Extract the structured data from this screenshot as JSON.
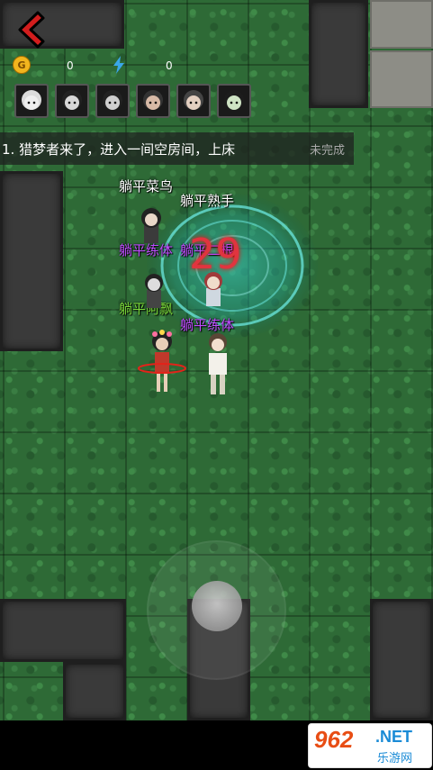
{
  "hud": {
    "coin_icon_letter": "G",
    "coins": "0",
    "energy": "0"
  },
  "avatars": [
    "avatar-1",
    "avatar-2",
    "avatar-3",
    "avatar-4",
    "avatar-5",
    "avatar-6"
  ],
  "task": {
    "text": "1. 猎梦者来了，进入一间空房间，上床",
    "status": "未完成"
  },
  "players": [
    {
      "name": "躺平菜鸟",
      "color": "#ffffff"
    },
    {
      "name": "躺平熟手",
      "color": "#ffffff"
    },
    {
      "name": "躺平练体",
      "color": "#c04cff"
    },
    {
      "name": "躺平二根",
      "color": "#c04cff"
    },
    {
      "name": "躺平阿飘",
      "color": "#7cdc3b"
    },
    {
      "name": "躺平练体",
      "color": "#c04cff"
    }
  ],
  "timer": "29",
  "watermark": {
    "number": "962",
    "net": ".NET",
    "sub": "乐游网"
  },
  "colors": {
    "grass": "#2e6a36",
    "back_arrow": "#d21d1d",
    "timer": "#e0343f",
    "portal": "#22c6c0"
  }
}
